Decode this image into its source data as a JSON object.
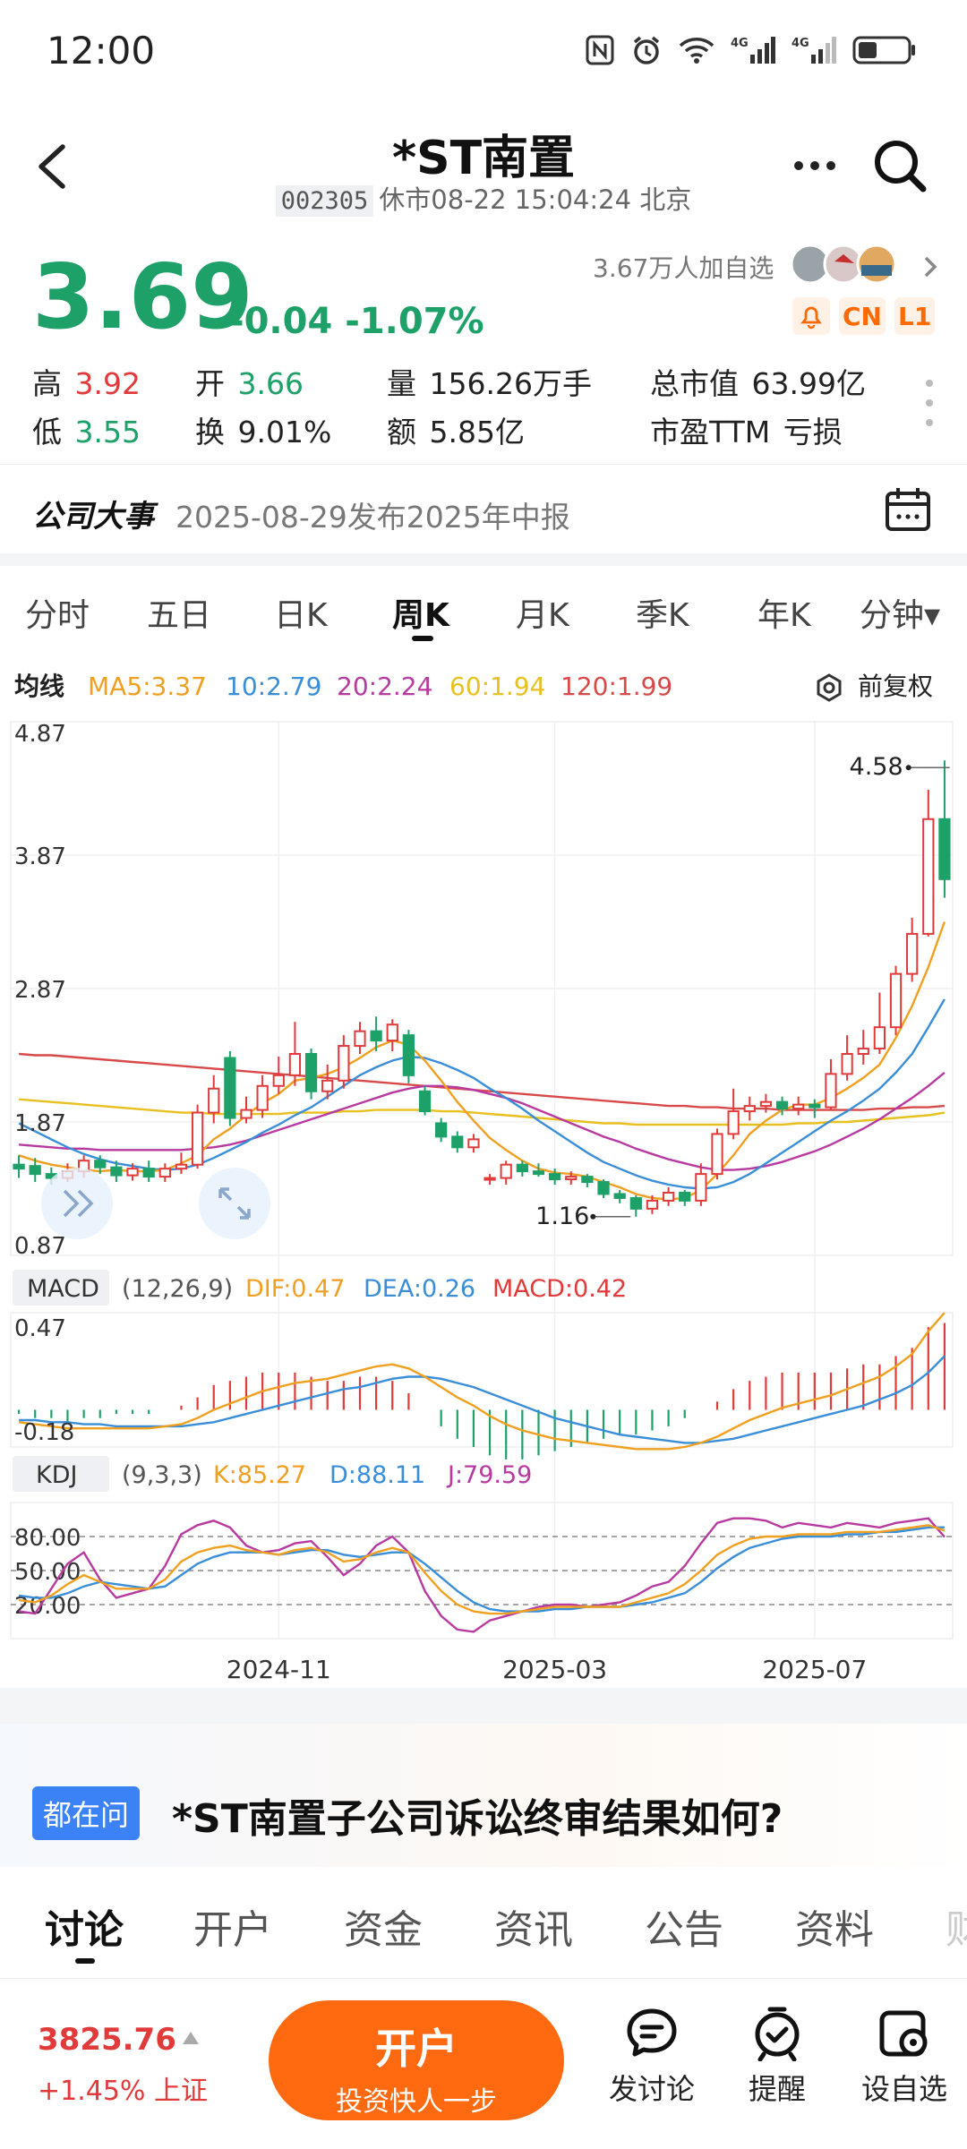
{
  "status_bar": {
    "time": "12:00"
  },
  "header": {
    "title": "*ST南置",
    "code": "002305",
    "market_status": "休市08-22 15:04:24 北京"
  },
  "quote": {
    "price": "3.69",
    "change": "-0.04 -1.07%",
    "followers": "3.67万人加自选",
    "badges": [
      "CN",
      "L1"
    ],
    "stats": [
      {
        "label": "高",
        "value": "3.92"
      },
      {
        "label": "开",
        "value": "3.66"
      },
      {
        "label": "量",
        "value": "156.26万手"
      },
      {
        "label": "总市值",
        "value": "63.99亿"
      },
      {
        "label": "低",
        "value": "3.55"
      },
      {
        "label": "换",
        "value": "9.01%"
      },
      {
        "label": "额",
        "value": "5.85亿"
      },
      {
        "label": "市盈TTM",
        "value": "亏损"
      }
    ]
  },
  "event": {
    "label": "公司大事",
    "text": "2025-08-29发布2025年中报"
  },
  "period_tabs": [
    "分时",
    "五日",
    "日K",
    "周K",
    "月K",
    "季K",
    "年K",
    "分钟▾"
  ],
  "active_period": "周K",
  "colors": {
    "up": "#e03a3a",
    "down": "#1ea069",
    "accent": "#ff6a10",
    "ma5": "#f0a020",
    "ma10": "#3a8ed8",
    "ma20": "#b83aa0",
    "ma60": "#e8c020",
    "ma120": "#d84a4a"
  },
  "chart_data": {
    "type": "candlestick",
    "ma_header": {
      "label": "均线",
      "items": [
        "MA5:3.37",
        "10:2.79",
        "20:2.24",
        "60:1.94",
        "120:1.99"
      ],
      "adjust": "前复权"
    },
    "ylim": [
      0.87,
      4.87
    ],
    "y_ticks": [
      "4.87",
      "3.87",
      "2.87",
      "1.87",
      "0.87"
    ],
    "x_ticks": [
      {
        "label": "2024-11",
        "index": 16
      },
      {
        "label": "2025-03",
        "index": 33
      },
      {
        "label": "2025-07",
        "index": 49
      }
    ],
    "annotations": {
      "high": {
        "label": "4.58",
        "index": 55,
        "value": 4.58
      },
      "low": {
        "label": "1.16",
        "index": 38,
        "value": 1.16
      }
    },
    "candles": [
      [
        1.55,
        1.52,
        1.62,
        1.45
      ],
      [
        1.54,
        1.48,
        1.6,
        1.42
      ],
      [
        1.48,
        1.45,
        1.53,
        1.4
      ],
      [
        1.45,
        1.5,
        1.56,
        1.42
      ],
      [
        1.5,
        1.58,
        1.62,
        1.45
      ],
      [
        1.58,
        1.53,
        1.62,
        1.48
      ],
      [
        1.53,
        1.47,
        1.58,
        1.42
      ],
      [
        1.47,
        1.52,
        1.56,
        1.43
      ],
      [
        1.52,
        1.46,
        1.58,
        1.42
      ],
      [
        1.46,
        1.52,
        1.56,
        1.42
      ],
      [
        1.52,
        1.55,
        1.64,
        1.48
      ],
      [
        1.55,
        1.94,
        2.0,
        1.52
      ],
      [
        1.94,
        2.12,
        2.22,
        1.86
      ],
      [
        2.35,
        1.9,
        2.4,
        1.84
      ],
      [
        1.9,
        1.96,
        2.06,
        1.86
      ],
      [
        1.96,
        2.14,
        2.22,
        1.9
      ],
      [
        2.14,
        2.22,
        2.36,
        2.08
      ],
      [
        2.22,
        2.38,
        2.62,
        2.14
      ],
      [
        2.38,
        2.1,
        2.42,
        2.04
      ],
      [
        2.1,
        2.18,
        2.3,
        2.04
      ],
      [
        2.18,
        2.44,
        2.52,
        2.12
      ],
      [
        2.44,
        2.55,
        2.62,
        2.38
      ],
      [
        2.55,
        2.48,
        2.66,
        2.4
      ],
      [
        2.48,
        2.6,
        2.64,
        2.4
      ],
      [
        2.52,
        2.22,
        2.56,
        2.16
      ],
      [
        2.1,
        1.95,
        2.14,
        1.92
      ],
      [
        1.86,
        1.76,
        1.9,
        1.72
      ],
      [
        1.76,
        1.68,
        1.8,
        1.64
      ],
      [
        1.68,
        1.74,
        1.78,
        1.64
      ],
      [
        1.45,
        1.45,
        1.48,
        1.4
      ],
      [
        1.45,
        1.55,
        1.58,
        1.4
      ],
      [
        1.55,
        1.5,
        1.58,
        1.46
      ],
      [
        1.5,
        1.48,
        1.56,
        1.46
      ],
      [
        1.48,
        1.44,
        1.52,
        1.4
      ],
      [
        1.44,
        1.46,
        1.5,
        1.4
      ],
      [
        1.46,
        1.42,
        1.48,
        1.38
      ],
      [
        1.42,
        1.33,
        1.44,
        1.3
      ],
      [
        1.33,
        1.3,
        1.36,
        1.26
      ],
      [
        1.3,
        1.22,
        1.32,
        1.16
      ],
      [
        1.22,
        1.28,
        1.32,
        1.18
      ],
      [
        1.28,
        1.34,
        1.38,
        1.24
      ],
      [
        1.34,
        1.28,
        1.36,
        1.24
      ],
      [
        1.28,
        1.48,
        1.56,
        1.24
      ],
      [
        1.48,
        1.78,
        1.82,
        1.44
      ],
      [
        1.78,
        1.95,
        2.12,
        1.74
      ],
      [
        1.95,
        1.99,
        2.06,
        1.88
      ],
      [
        1.99,
        2.02,
        2.08,
        1.94
      ],
      [
        2.02,
        1.97,
        2.06,
        1.92
      ],
      [
        1.97,
        2.0,
        2.06,
        1.92
      ],
      [
        2.0,
        1.98,
        2.04,
        1.9
      ],
      [
        1.98,
        2.23,
        2.34,
        1.96
      ],
      [
        2.23,
        2.38,
        2.52,
        2.18
      ],
      [
        2.38,
        2.42,
        2.56,
        2.3
      ],
      [
        2.42,
        2.58,
        2.84,
        2.38
      ],
      [
        2.58,
        2.98,
        3.04,
        2.52
      ],
      [
        2.98,
        3.28,
        3.4,
        2.92
      ],
      [
        3.28,
        4.14,
        4.36,
        3.26
      ],
      [
        4.14,
        3.69,
        4.58,
        3.55
      ]
    ],
    "ma5": [
      1.62,
      1.58,
      1.55,
      1.53,
      1.51,
      1.5,
      1.51,
      1.5,
      1.5,
      1.51,
      1.56,
      1.62,
      1.74,
      1.82,
      1.92,
      2.01,
      2.08,
      2.18,
      2.2,
      2.23,
      2.28,
      2.35,
      2.43,
      2.48,
      2.45,
      2.33,
      2.18,
      2.02,
      1.88,
      1.75,
      1.66,
      1.58,
      1.52,
      1.49,
      1.48,
      1.46,
      1.42,
      1.38,
      1.33,
      1.3,
      1.29,
      1.3,
      1.36,
      1.48,
      1.62,
      1.78,
      1.88,
      1.96,
      2.0,
      2.0,
      2.05,
      2.12,
      2.2,
      2.3,
      2.5,
      2.74,
      3.03,
      3.37
    ],
    "ma10": [
      1.86,
      1.8,
      1.74,
      1.68,
      1.63,
      1.59,
      1.56,
      1.54,
      1.52,
      1.51,
      1.52,
      1.55,
      1.6,
      1.66,
      1.72,
      1.79,
      1.85,
      1.92,
      1.98,
      2.06,
      2.14,
      2.22,
      2.28,
      2.33,
      2.36,
      2.35,
      2.31,
      2.26,
      2.2,
      2.12,
      2.05,
      1.97,
      1.88,
      1.8,
      1.72,
      1.64,
      1.57,
      1.52,
      1.47,
      1.43,
      1.4,
      1.38,
      1.37,
      1.38,
      1.42,
      1.48,
      1.56,
      1.64,
      1.72,
      1.8,
      1.88,
      1.95,
      2.03,
      2.12,
      2.24,
      2.38,
      2.58,
      2.79
    ],
    "ma20": [
      1.7,
      1.69,
      1.68,
      1.67,
      1.67,
      1.66,
      1.66,
      1.66,
      1.66,
      1.66,
      1.66,
      1.67,
      1.68,
      1.7,
      1.73,
      1.77,
      1.81,
      1.85,
      1.89,
      1.93,
      1.97,
      2.01,
      2.05,
      2.09,
      2.12,
      2.14,
      2.14,
      2.13,
      2.11,
      2.08,
      2.05,
      2.01,
      1.96,
      1.91,
      1.86,
      1.81,
      1.76,
      1.72,
      1.67,
      1.63,
      1.59,
      1.56,
      1.53,
      1.51,
      1.51,
      1.52,
      1.54,
      1.57,
      1.61,
      1.65,
      1.7,
      1.76,
      1.82,
      1.89,
      1.97,
      2.05,
      2.14,
      2.24
    ],
    "ma60": [
      2.04,
      2.03,
      2.02,
      2.01,
      2.0,
      1.99,
      1.98,
      1.97,
      1.96,
      1.95,
      1.94,
      1.94,
      1.93,
      1.93,
      1.93,
      1.93,
      1.93,
      1.94,
      1.94,
      1.94,
      1.95,
      1.95,
      1.96,
      1.96,
      1.96,
      1.96,
      1.95,
      1.95,
      1.94,
      1.93,
      1.92,
      1.91,
      1.9,
      1.89,
      1.88,
      1.87,
      1.86,
      1.86,
      1.85,
      1.85,
      1.85,
      1.85,
      1.85,
      1.85,
      1.85,
      1.85,
      1.85,
      1.85,
      1.86,
      1.86,
      1.87,
      1.87,
      1.88,
      1.89,
      1.9,
      1.91,
      1.92,
      1.94
    ],
    "ma120": [
      2.38,
      2.37,
      2.37,
      2.36,
      2.35,
      2.34,
      2.33,
      2.32,
      2.31,
      2.3,
      2.29,
      2.28,
      2.27,
      2.26,
      2.25,
      2.24,
      2.23,
      2.22,
      2.21,
      2.2,
      2.19,
      2.18,
      2.17,
      2.16,
      2.15,
      2.14,
      2.13,
      2.12,
      2.11,
      2.1,
      2.09,
      2.08,
      2.07,
      2.06,
      2.05,
      2.04,
      2.03,
      2.02,
      2.01,
      2.0,
      1.99,
      1.99,
      1.98,
      1.98,
      1.97,
      1.97,
      1.97,
      1.96,
      1.96,
      1.96,
      1.96,
      1.96,
      1.96,
      1.97,
      1.97,
      1.98,
      1.98,
      1.99
    ],
    "macd": {
      "header": {
        "label": "MACD",
        "params": "(12,26,9)",
        "items": [
          "DIF:0.47",
          "DEA:0.26",
          "MACD:0.42"
        ]
      },
      "ylim": [
        -0.18,
        0.47
      ],
      "y_ticks": [
        "0.47",
        "-0.18"
      ],
      "dif": [
        -0.06,
        -0.07,
        -0.08,
        -0.09,
        -0.09,
        -0.09,
        -0.09,
        -0.09,
        -0.09,
        -0.08,
        -0.07,
        -0.04,
        0.0,
        0.03,
        0.06,
        0.09,
        0.11,
        0.13,
        0.14,
        0.15,
        0.17,
        0.19,
        0.21,
        0.22,
        0.2,
        0.16,
        0.11,
        0.06,
        0.02,
        -0.03,
        -0.07,
        -0.1,
        -0.12,
        -0.14,
        -0.15,
        -0.16,
        -0.17,
        -0.18,
        -0.19,
        -0.19,
        -0.19,
        -0.18,
        -0.16,
        -0.13,
        -0.09,
        -0.05,
        -0.02,
        0.01,
        0.03,
        0.05,
        0.07,
        0.1,
        0.13,
        0.16,
        0.21,
        0.27,
        0.38,
        0.47
      ],
      "dea": [
        -0.05,
        -0.05,
        -0.06,
        -0.06,
        -0.07,
        -0.07,
        -0.08,
        -0.08,
        -0.08,
        -0.08,
        -0.08,
        -0.07,
        -0.06,
        -0.04,
        -0.02,
        0.0,
        0.02,
        0.04,
        0.06,
        0.08,
        0.1,
        0.11,
        0.13,
        0.15,
        0.16,
        0.16,
        0.15,
        0.13,
        0.11,
        0.08,
        0.05,
        0.02,
        -0.01,
        -0.04,
        -0.06,
        -0.08,
        -0.1,
        -0.12,
        -0.13,
        -0.14,
        -0.15,
        -0.16,
        -0.16,
        -0.15,
        -0.14,
        -0.12,
        -0.1,
        -0.08,
        -0.06,
        -0.04,
        -0.02,
        0.0,
        0.02,
        0.05,
        0.08,
        0.12,
        0.18,
        0.26
      ],
      "hist": [
        -0.02,
        -0.04,
        -0.04,
        -0.06,
        -0.04,
        -0.04,
        -0.02,
        -0.02,
        -0.02,
        0.0,
        0.02,
        0.06,
        0.12,
        0.14,
        0.16,
        0.18,
        0.18,
        0.18,
        0.16,
        0.14,
        0.14,
        0.16,
        0.16,
        0.14,
        0.08,
        0.0,
        -0.08,
        -0.14,
        -0.18,
        -0.22,
        -0.24,
        -0.24,
        -0.22,
        -0.2,
        -0.18,
        -0.16,
        -0.14,
        -0.12,
        -0.12,
        -0.1,
        -0.08,
        -0.04,
        0.0,
        0.04,
        0.1,
        0.14,
        0.16,
        0.18,
        0.18,
        0.18,
        0.18,
        0.2,
        0.22,
        0.22,
        0.26,
        0.3,
        0.4,
        0.42
      ]
    },
    "kdj": {
      "header": {
        "label": "KDJ",
        "params": "(9,3,3)",
        "items": [
          "K:85.27",
          "D:88.11",
          "J:79.59"
        ]
      },
      "ylim": [
        -10,
        110
      ],
      "y_ticks": [
        "80.00",
        "50.00",
        "20.00"
      ],
      "k": [
        24,
        22,
        28,
        38,
        46,
        40,
        34,
        34,
        34,
        42,
        58,
        66,
        70,
        72,
        68,
        66,
        64,
        68,
        70,
        66,
        58,
        60,
        66,
        70,
        66,
        48,
        32,
        20,
        14,
        12,
        12,
        14,
        16,
        18,
        18,
        18,
        18,
        18,
        22,
        26,
        30,
        38,
        50,
        64,
        72,
        78,
        80,
        80,
        82,
        82,
        82,
        84,
        84,
        84,
        86,
        88,
        90,
        85.27
      ],
      "d": [
        28,
        26,
        26,
        30,
        36,
        40,
        38,
        36,
        34,
        36,
        46,
        56,
        62,
        66,
        66,
        66,
        64,
        66,
        68,
        68,
        64,
        62,
        64,
        66,
        66,
        56,
        44,
        32,
        22,
        16,
        14,
        14,
        14,
        16,
        16,
        18,
        18,
        18,
        20,
        22,
        26,
        30,
        40,
        52,
        62,
        70,
        74,
        78,
        80,
        80,
        80,
        82,
        82,
        84,
        84,
        86,
        88,
        88.11
      ],
      "j": [
        14,
        12,
        34,
        56,
        66,
        42,
        26,
        30,
        34,
        54,
        82,
        90,
        94,
        88,
        72,
        66,
        68,
        74,
        76,
        62,
        46,
        56,
        72,
        80,
        66,
        32,
        10,
        -2,
        -4,
        6,
        10,
        14,
        18,
        20,
        20,
        18,
        20,
        22,
        28,
        36,
        40,
        54,
        74,
        92,
        96,
        96,
        94,
        88,
        92,
        90,
        88,
        92,
        90,
        88,
        92,
        94,
        96,
        79.59
      ]
    }
  },
  "ask": {
    "badge": "都在问",
    "text": "*ST南置子公司诉讼终审结果如何?"
  },
  "bottom_tabs": [
    "讨论",
    "开户",
    "资金",
    "资讯",
    "公告",
    "资料",
    "财"
  ],
  "bottom_bar": {
    "index_value": "3825.76",
    "index_change": "+1.45% 上证",
    "open_button": {
      "title": "开户",
      "subtitle": "投资快人一步"
    },
    "actions": [
      {
        "label": "发讨论",
        "icon": "chat-icon"
      },
      {
        "label": "提醒",
        "icon": "alarm-icon"
      },
      {
        "label": "设自选",
        "icon": "settings-icon"
      }
    ]
  }
}
